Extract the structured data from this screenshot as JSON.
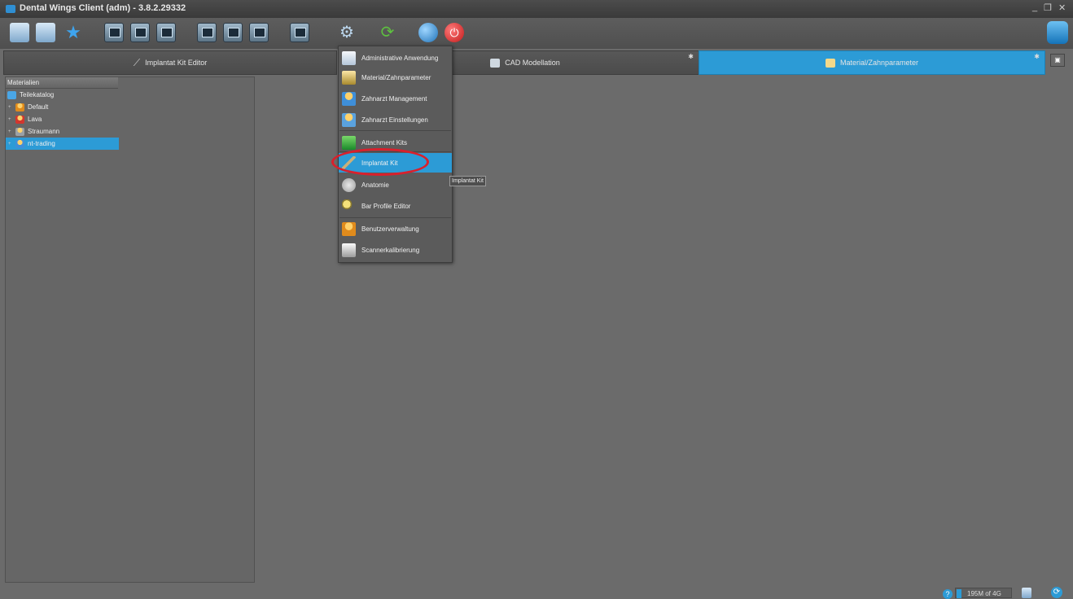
{
  "window": {
    "title": "Dental Wings Client (adm) - 3.8.2.29332",
    "minimize_label": "_",
    "restore_label": "❐",
    "close_label": "✕"
  },
  "toolbar": {
    "icons": [
      "pencil-icon",
      "open-case-icon",
      "star-icon",
      "monitor-icon",
      "monitor-icon",
      "monitor-icon",
      "monitor-icon",
      "monitor-icon",
      "monitor-icon",
      "monitor-icon",
      "gear-icon",
      "sync-icon",
      "globe-icon",
      "power-icon",
      "stack-icon"
    ]
  },
  "tabs": [
    {
      "label": "Implantat Kit Editor",
      "active": false
    },
    {
      "label": "CAD Modellation",
      "active": false
    },
    {
      "label": "Material/Zahnparameter",
      "active": true
    }
  ],
  "sidebar": {
    "header": "Materialien",
    "items": [
      {
        "label": "Teilekatalog",
        "icon": "catalog-icon"
      },
      {
        "label": "Default",
        "icon": "person-icon"
      },
      {
        "label": "Lava",
        "icon": "person-icon"
      },
      {
        "label": "Straumann",
        "icon": "person-icon"
      },
      {
        "label": "nt-trading",
        "icon": "person-icon",
        "selected": true
      }
    ]
  },
  "menu": {
    "items": [
      {
        "label": "Administrative Anwendung",
        "icon": "admin-icon"
      },
      {
        "label": "Material/Zahnparameter",
        "icon": "material-icon"
      },
      {
        "label": "Zahnarzt Management",
        "icon": "dentist-icon"
      },
      {
        "label": "Zahnarzt Einstellungen",
        "icon": "dentist-settings-icon"
      },
      {
        "label": "Attachment Kits",
        "icon": "attachment-icon"
      },
      {
        "label": "Implantat Kit",
        "icon": "implant-icon",
        "highlighted": true
      },
      {
        "label": "Anatomie",
        "icon": "anatomy-icon"
      },
      {
        "label": "Bar Profile Editor",
        "icon": "bar-profile-icon"
      },
      {
        "label": "Benutzerverwaltung",
        "icon": "user-admin-icon"
      },
      {
        "label": "Scannerkalibrierung",
        "icon": "scanner-icon"
      }
    ]
  },
  "tooltip": "Implantat Kit",
  "status": {
    "memory": "195M of 4G"
  },
  "colors": {
    "accent": "#2c9bd6",
    "background": "#6b6b6b",
    "highlight_oval": "#d9202c"
  }
}
